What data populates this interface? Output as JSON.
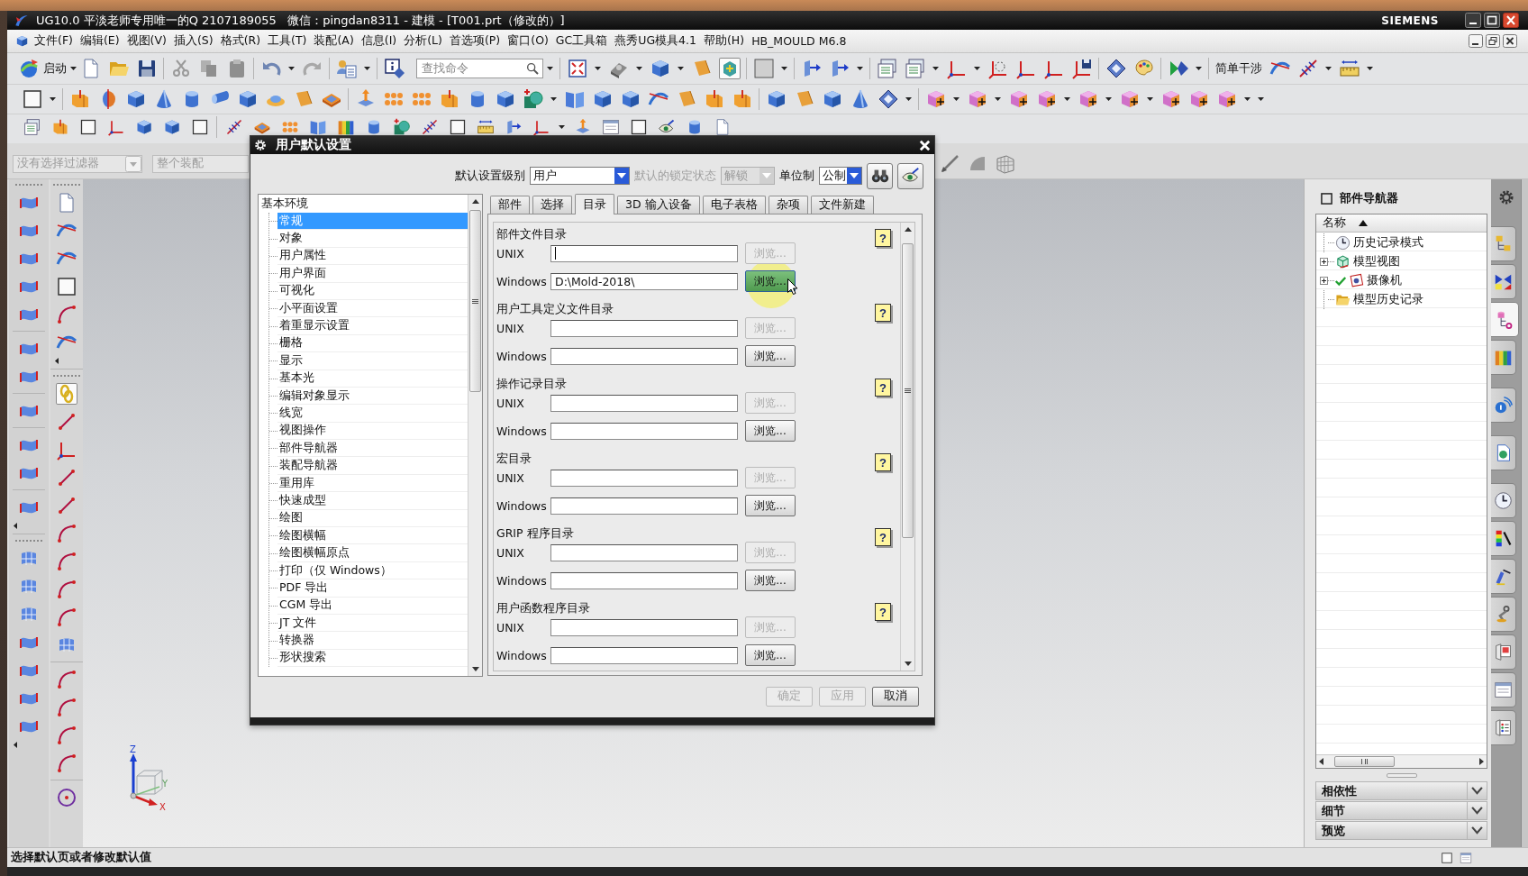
{
  "window": {
    "title": "UG10.0 平淡老师专用唯一的Q 2107189055   微信：pingdan8311 - 建模 - [T001.prt（修改的）]",
    "brand": "SIEMENS"
  },
  "menu_bar": [
    "文件(F)",
    "编辑(E)",
    "视图(V)",
    "插入(S)",
    "格式(R)",
    "工具(T)",
    "装配(A)",
    "信息(I)",
    "分析(L)",
    "首选项(P)",
    "窗口(O)",
    "GC工具箱",
    "燕秀UG模具4.1",
    "帮助(H)",
    "HB_MOULD M6.8"
  ],
  "toolbar": {
    "start_label": "启动",
    "search": {
      "placeholder": "查找命令"
    },
    "toggle_button": {
      "on": true
    },
    "interference_label": "简单干涉"
  },
  "selection_bar": {
    "filter": "没有选择过滤器",
    "scope": "整个装配",
    "disabled": true
  },
  "side_toolbar": {
    "toggle_button": {
      "on": true
    }
  },
  "view_triad": {
    "z_label": "Z",
    "y_label": "Y",
    "x_label": "X"
  },
  "dialog": {
    "title": "用户默认设置",
    "level": {
      "label": "默认设置级别",
      "value": "用户"
    },
    "lock": {
      "label": "默认的锁定状态",
      "value": "解锁",
      "disabled": true
    },
    "units": {
      "label": "单位制",
      "value": "公制"
    },
    "tree": {
      "label": "基本环境",
      "children": [
        {
          "label": "常规",
          "selected": true
        },
        {
          "label": "对象",
          "selected": false
        },
        {
          "label": "用户属性",
          "selected": false
        },
        {
          "label": "用户界面",
          "selected": false
        },
        {
          "label": "可视化",
          "selected": false
        },
        {
          "label": "小平面设置",
          "selected": false
        },
        {
          "label": "着重显示设置",
          "selected": false
        },
        {
          "label": "栅格",
          "selected": false
        },
        {
          "label": "显示",
          "selected": false
        },
        {
          "label": "基本光",
          "selected": false
        },
        {
          "label": "编辑对象显示",
          "selected": false
        },
        {
          "label": "线宽",
          "selected": false
        },
        {
          "label": "视图操作",
          "selected": false
        },
        {
          "label": "部件导航器",
          "selected": false
        },
        {
          "label": "装配导航器",
          "selected": false
        },
        {
          "label": "重用库",
          "selected": false
        },
        {
          "label": "快速成型",
          "selected": false
        },
        {
          "label": "绘图",
          "selected": false
        },
        {
          "label": "绘图横幅",
          "selected": false
        },
        {
          "label": "绘图横幅原点",
          "selected": false
        },
        {
          "label": "打印（仅 Windows）",
          "selected": false
        },
        {
          "label": "PDF 导出",
          "selected": false
        },
        {
          "label": "CGM 导出",
          "selected": false
        },
        {
          "label": "JT 文件",
          "selected": false
        },
        {
          "label": "转换器",
          "selected": false
        },
        {
          "label": "形状搜索",
          "selected": false
        }
      ]
    },
    "tabs": [
      {
        "label": "部件",
        "selected": false
      },
      {
        "label": "选择",
        "selected": false
      },
      {
        "label": "目录",
        "selected": true
      },
      {
        "label": "3D 输入设备",
        "selected": false
      },
      {
        "label": "电子表格",
        "selected": false
      },
      {
        "label": "杂项",
        "selected": false
      },
      {
        "label": "文件新建",
        "selected": false
      }
    ],
    "sections": [
      {
        "title": "部件文件目录",
        "help": "?",
        "rows": [
          {
            "label": "UNIX",
            "focused": true,
            "button": {
              "label": "浏览...",
              "disabled": true,
              "hovered": false
            }
          },
          {
            "label": "Windows",
            "value": "D:\\Mold-2018\\",
            "focused": false,
            "button": {
              "label": "浏览...",
              "disabled": false,
              "hovered": true
            }
          }
        ]
      },
      {
        "title": "用户工具定义文件目录",
        "help": "?",
        "rows": [
          {
            "label": "UNIX",
            "focused": false,
            "button": {
              "label": "浏览...",
              "disabled": true,
              "hovered": false
            }
          },
          {
            "label": "Windows",
            "focused": false,
            "button": {
              "label": "浏览...",
              "disabled": false,
              "hovered": false
            }
          }
        ]
      },
      {
        "title": "操作记录目录",
        "help": "?",
        "rows": [
          {
            "label": "UNIX",
            "focused": false,
            "button": {
              "label": "浏览...",
              "disabled": true,
              "hovered": false
            }
          },
          {
            "label": "Windows",
            "focused": false,
            "button": {
              "label": "浏览...",
              "disabled": false,
              "hovered": false
            }
          }
        ]
      },
      {
        "title": "宏目录",
        "help": "?",
        "rows": [
          {
            "label": "UNIX",
            "focused": false,
            "button": {
              "label": "浏览...",
              "disabled": true,
              "hovered": false
            }
          },
          {
            "label": "Windows",
            "focused": false,
            "button": {
              "label": "浏览...",
              "disabled": false,
              "hovered": false
            }
          }
        ]
      },
      {
        "title": "GRIP 程序目录",
        "help": "?",
        "rows": [
          {
            "label": "UNIX",
            "focused": false,
            "button": {
              "label": "浏览...",
              "disabled": true,
              "hovered": false
            }
          },
          {
            "label": "Windows",
            "focused": false,
            "button": {
              "label": "浏览...",
              "disabled": false,
              "hovered": false
            }
          }
        ]
      },
      {
        "title": "用户函数程序目录",
        "help": "?",
        "rows": [
          {
            "label": "UNIX",
            "focused": false,
            "button": {
              "label": "浏览...",
              "disabled": true,
              "hovered": false
            }
          },
          {
            "label": "Windows",
            "focused": false,
            "button": {
              "label": "浏览...",
              "disabled": false,
              "hovered": false
            }
          }
        ]
      }
    ],
    "buttons": [
      {
        "label": "确定",
        "disabled": true
      },
      {
        "label": "应用",
        "disabled": true
      },
      {
        "label": "取消",
        "disabled": false
      }
    ]
  },
  "part_navigator": {
    "title": "部件导航器",
    "column": "名称",
    "items": [
      {
        "label": "历史记录模式",
        "kind": "clock",
        "expandable": false,
        "expanded": false,
        "checked": false
      },
      {
        "label": "模型视图",
        "kind": "views",
        "expandable": true,
        "expanded": false,
        "checked": false
      },
      {
        "label": "摄像机",
        "kind": "camera",
        "expandable": true,
        "expanded": false,
        "checked": true
      },
      {
        "label": "模型历史记录",
        "kind": "folder",
        "expandable": false,
        "expanded": false,
        "checked": false
      }
    ],
    "panels": [
      {
        "label": "相依性",
        "expanded": false
      },
      {
        "label": "细节",
        "expanded": false
      },
      {
        "label": "预览",
        "expanded": false
      }
    ]
  },
  "resource_bar": {
    "tabs": [
      {
        "selected": false
      },
      {
        "selected": false
      },
      {
        "selected": true
      },
      {
        "selected": false
      },
      {
        "selected": false
      },
      {
        "selected": false
      },
      {
        "selected": false
      },
      {
        "selected": false
      },
      {
        "selected": false
      },
      {
        "selected": false
      },
      {
        "selected": false
      },
      {
        "selected": false
      },
      {
        "selected": false
      }
    ]
  },
  "status_bar": {
    "text": "选择默认页或者修改默认值"
  }
}
